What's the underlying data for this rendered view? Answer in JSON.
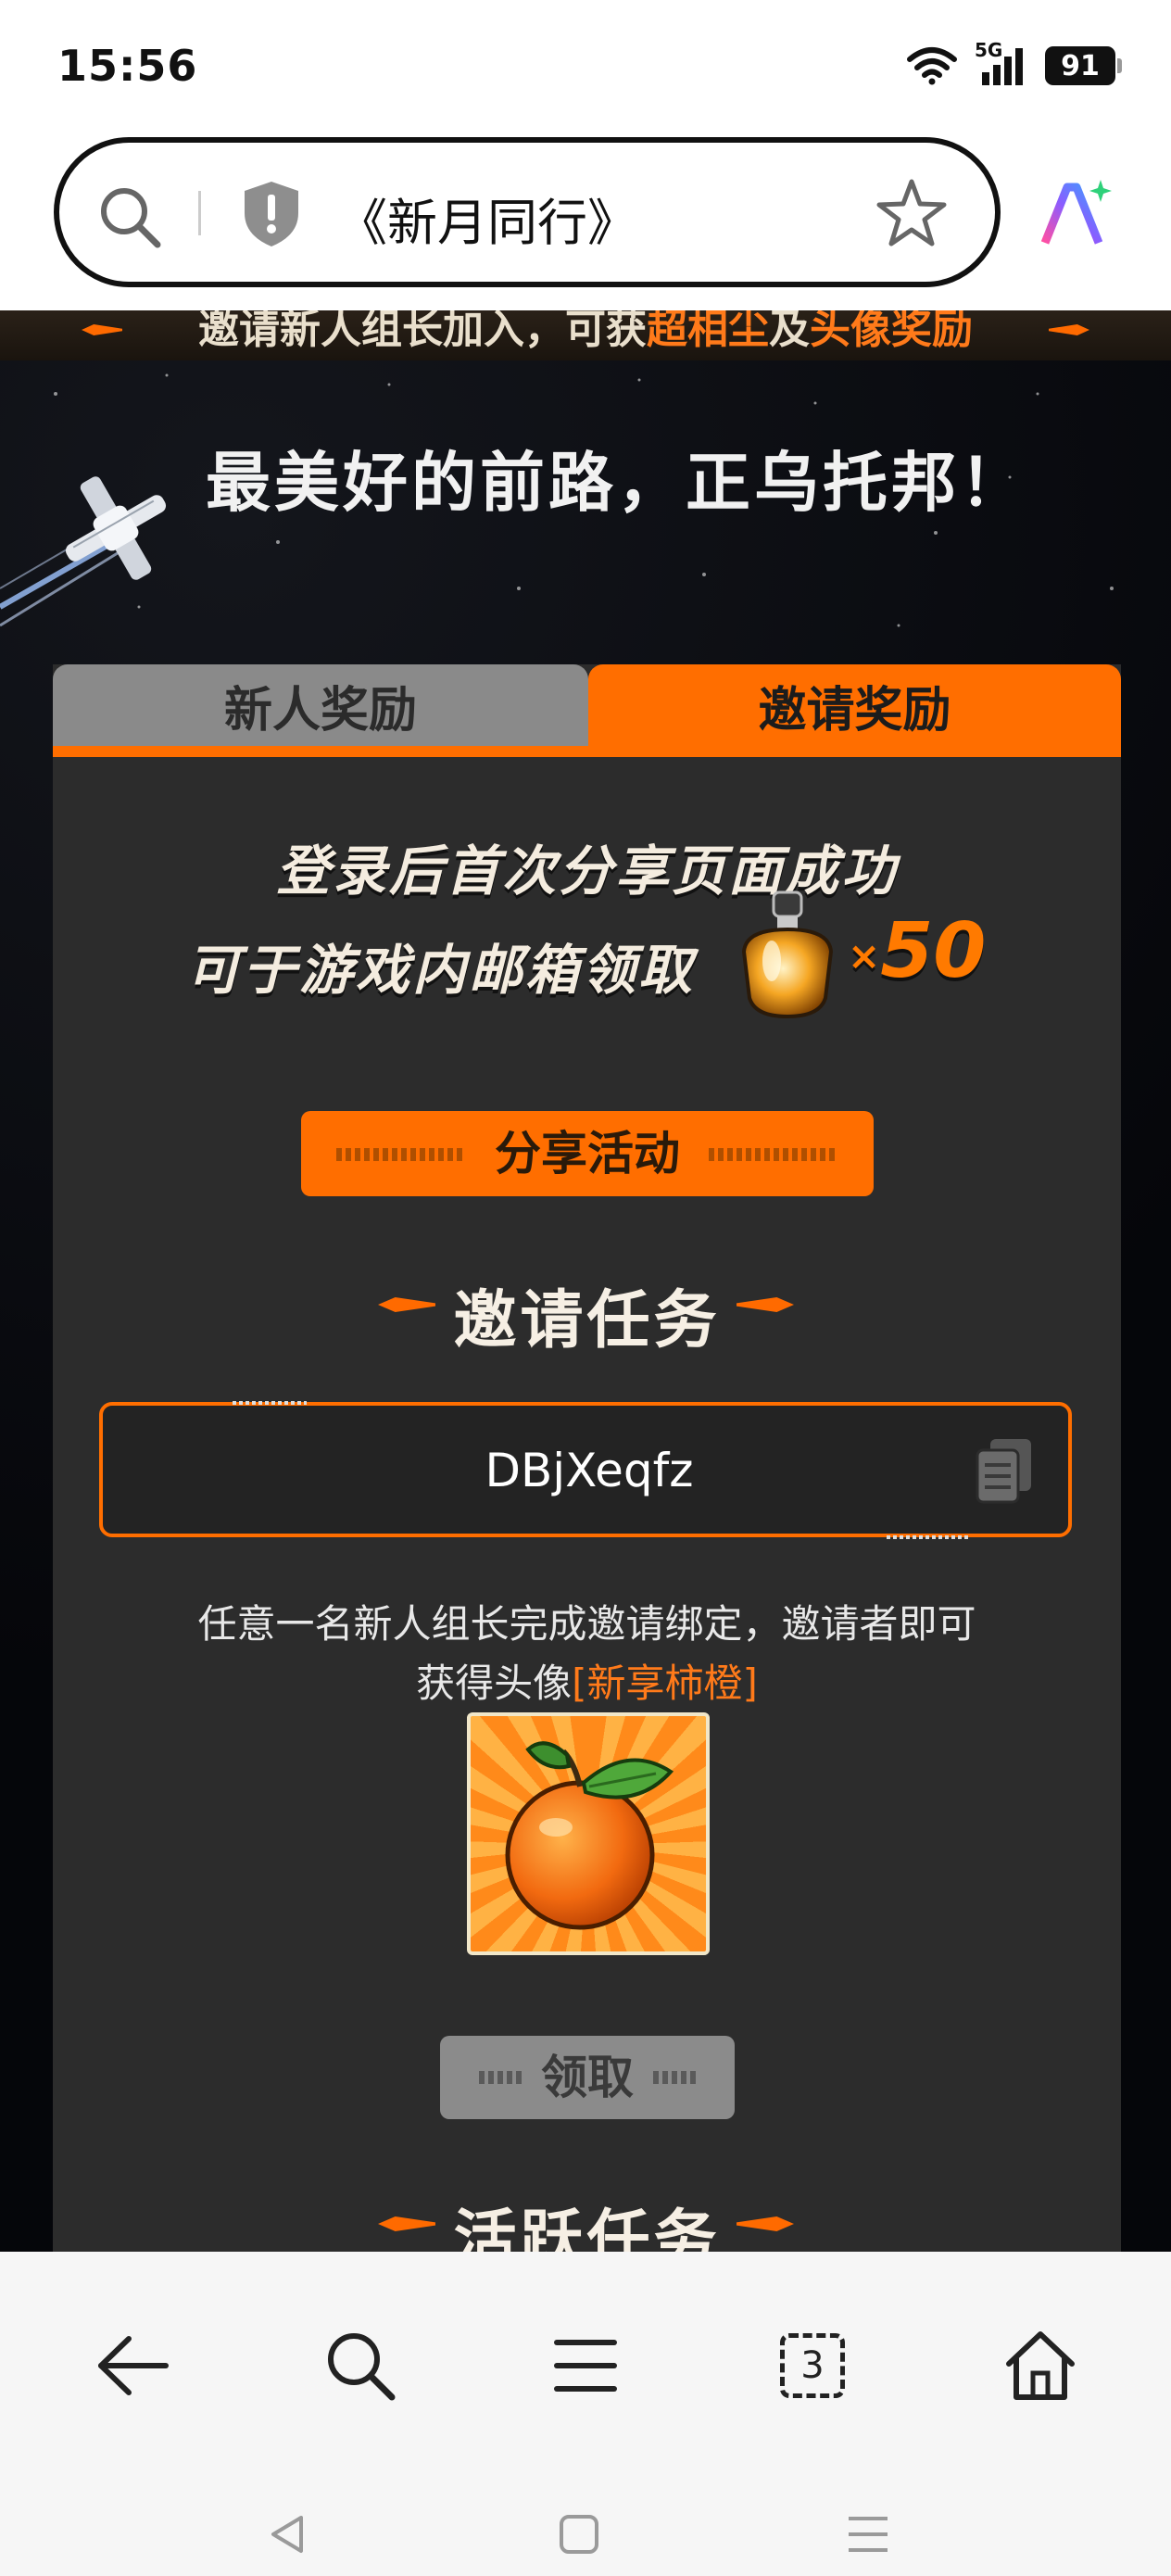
{
  "status_bar": {
    "time": "15:56",
    "network": "5G",
    "battery": "91",
    "icons": [
      "wifi-icon",
      "cellular-signal-icon",
      "battery-icon"
    ]
  },
  "address_bar": {
    "title": "《新月同行》",
    "icons": [
      "search-icon",
      "shield-warning-icon",
      "star-icon",
      "ai-assistant-icon"
    ]
  },
  "banner": {
    "prefix": "邀请新人组长加入，可获",
    "highlight1": "超相尘",
    "middle": "及",
    "highlight2": "头像奖励",
    "slogan": "最美好的前路，正乌托邦！"
  },
  "tabs": {
    "newcomer": "新人奖励",
    "invite": "邀请奖励",
    "active": "invite"
  },
  "share_reward": {
    "line1": "登录后首次分享页面成功",
    "line2": "可于游戏内邮箱领取",
    "count": "50",
    "times_symbol": "×",
    "share_button": "分享活动"
  },
  "invite_task": {
    "title": "邀请任务",
    "code": "DBjXeqfz",
    "desc_line1": "任意一名新人组长完成邀请绑定，邀请者即可",
    "desc_line2_prefix": "获得头像",
    "avatar_name": "[新享柿橙]",
    "claim_button": "领取"
  },
  "active_task": {
    "title": "活跃任务"
  },
  "bottom_nav": {
    "items": [
      "back-arrow-icon",
      "search-icon",
      "menu-icon",
      "tabs-icon",
      "home-icon"
    ],
    "tab_count": "3"
  },
  "system_nav": [
    "back-triangle-icon",
    "home-square-icon",
    "recents-lines-icon"
  ],
  "colors": {
    "accent": "#ff6e00",
    "panel": "#2c2c2c",
    "tab_inactive": "#8a8a8a",
    "background": "#05060a"
  }
}
